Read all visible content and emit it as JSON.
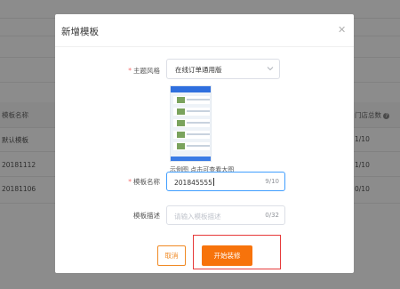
{
  "background": {
    "table": {
      "headers": {
        "name": "模板名称",
        "stores": "门店总数"
      },
      "rows": [
        {
          "name": "默认模板",
          "stores": "1/10"
        },
        {
          "name": "20181112",
          "stores": "1/10"
        },
        {
          "name": "20181106",
          "stores": "0/10"
        }
      ]
    }
  },
  "modal": {
    "title": "新增模板",
    "close_icon": "close-icon",
    "theme": {
      "label": "主题风格",
      "value": "在线订单通用版"
    },
    "preview": {
      "hint": "示例图 点击可查看大图"
    },
    "name": {
      "label": "模板名称",
      "value": "201845555",
      "counter": "9/10"
    },
    "description": {
      "label": "模板描述",
      "placeholder": "请输入模板描述",
      "counter": "0/32"
    },
    "buttons": {
      "cancel": "取消",
      "start": "开始装修"
    }
  },
  "colors": {
    "primary": "#f7730b",
    "focus": "#409eff",
    "required": "#f56c6c",
    "highlight": "#e63a3a"
  }
}
